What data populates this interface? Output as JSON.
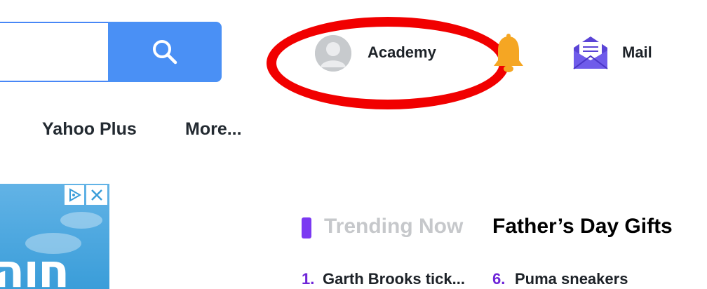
{
  "search": {
    "input_value": "",
    "placeholder": "",
    "button_icon": "search-icon",
    "accent_color": "#4a90f5"
  },
  "header": {
    "profile": {
      "name": "Academy",
      "avatar_icon": "user-avatar-icon"
    },
    "notifications": {
      "icon": "bell-icon",
      "color": "#f5a623"
    },
    "mail": {
      "icon": "mail-envelope-icon",
      "label": "Mail"
    },
    "highlight_color": "#f10000"
  },
  "nav": {
    "items": [
      {
        "label": "Yahoo Plus"
      },
      {
        "label": "More..."
      }
    ]
  },
  "ad": {
    "choices_icon": "ad-choices-icon",
    "close_icon": "close-icon",
    "visible_text": "חוה"
  },
  "trending": {
    "title": "Trending Now",
    "topic": "Father’s Day Gifts",
    "marker_color": "#7b39f2",
    "items": [
      {
        "rank": "1.",
        "text": "Garth Brooks tick..."
      },
      {
        "rank": "6.",
        "text": "Puma sneakers"
      }
    ]
  }
}
